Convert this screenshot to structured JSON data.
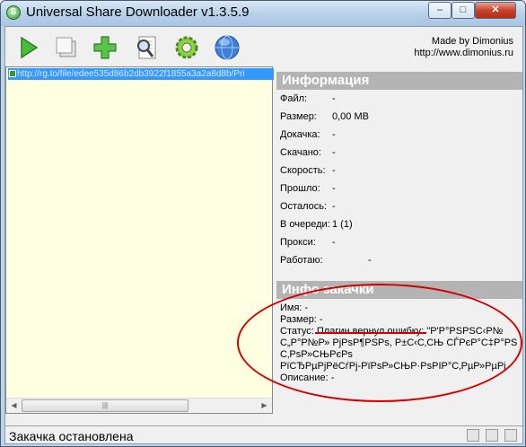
{
  "window": {
    "title": "Universal Share Downloader v1.3.5.9",
    "app_icon_glyph": "S",
    "minimize_glyph": "–",
    "maximize_glyph": "□",
    "close_glyph": "✕"
  },
  "toolbar": {
    "icons": [
      "play-icon",
      "stop-icon",
      "add-icon",
      "search-document-icon",
      "gear-icon",
      "globe-icon"
    ],
    "made_by": "Made by Dimonius",
    "website": "http://www.dimonius.ru"
  },
  "list": {
    "items": [
      {
        "url": "http://rg.to/file/edee535d86b2db3922f1855a3a2a8d8b/Pri"
      }
    ],
    "scroll_left": "◀",
    "scroll_right": "▶",
    "scroll_grip": "|||"
  },
  "info": {
    "header": "Информация",
    "rows": [
      {
        "label": "Файл:",
        "value": "-"
      },
      {
        "label": "Размер:",
        "value": "0,00 MB"
      },
      {
        "label": "Докачка:",
        "value": "-"
      },
      {
        "label": "Скачано:",
        "value": "-"
      },
      {
        "label": "Скорость:",
        "value": "-"
      },
      {
        "label": "Прошло:",
        "value": "-"
      },
      {
        "label": "Осталось:",
        "value": "-"
      },
      {
        "label": "В очереди:",
        "value": "1 (1)"
      },
      {
        "label": "Прокси:",
        "value": "-"
      },
      {
        "label": "Работаю:",
        "value": "-"
      }
    ]
  },
  "download_info": {
    "header": "Инфо закачки",
    "name_line": "Имя: -",
    "size_line": "Размер: -",
    "status_line_1": "Статус: Плагин вернул ошибку: \"Р'Р°РЅРЅС‹Р№",
    "status_line_2": "С„Р°Р№Р» РјРѕР¶РЅРѕ, Р±С‹С‚СЊ СЃРєР°С‡Р°РЅ",
    "status_line_3": "С‚РѕР»СЊРєРѕ",
    "status_line_4": "РїСЂРµРјРёСѓРј-РїРѕР»СЊР·РѕРІР°С‚РµР»РµРј",
    "description_line": "Описание: -"
  },
  "status_bar": {
    "text": "Закачка остановлена",
    "icons": [
      "tool-icon-1",
      "tool-icon-2",
      "tool-icon-3"
    ]
  },
  "colors": {
    "selection": "#3399ff",
    "list_background": "#ffffe1",
    "panel_header": "#b4b4b4",
    "annotation_red": "#d40000"
  }
}
